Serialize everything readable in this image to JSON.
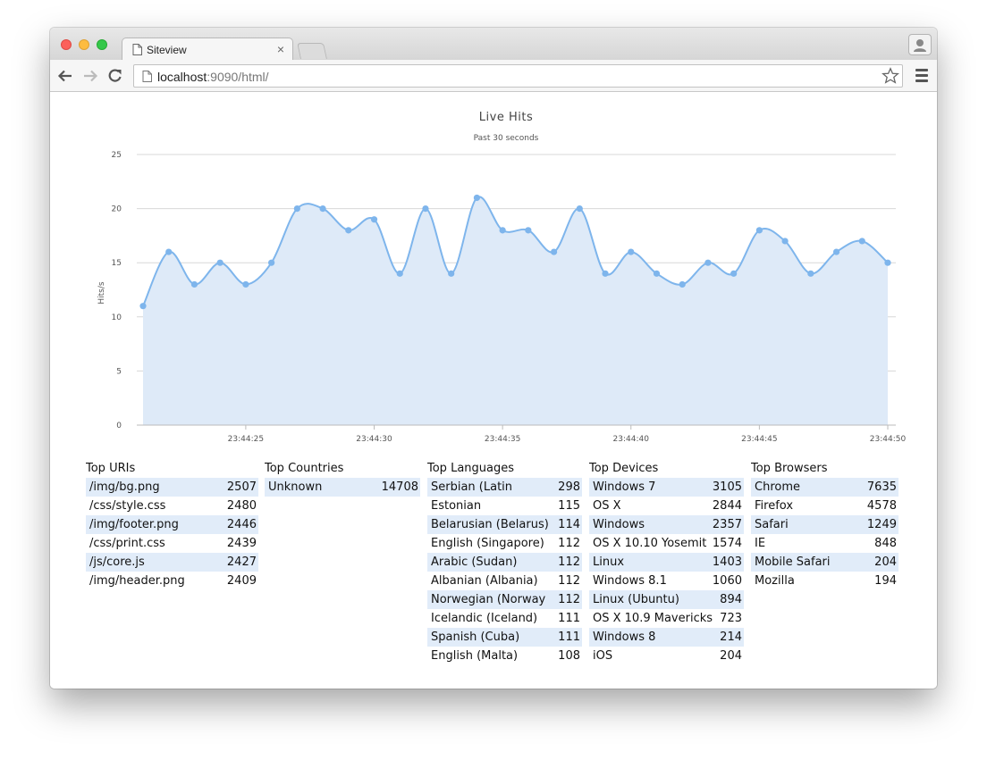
{
  "browser": {
    "tab_title": "Siteview",
    "tab_close": "×",
    "url_host": "localhost",
    "url_rest": ":9090/html/"
  },
  "chart_data": {
    "type": "area",
    "title": "Live Hits",
    "subtitle": "Past 30 seconds",
    "ylabel": "Hits/s",
    "xlabel": "",
    "ylim": [
      0,
      25
    ],
    "yticks": [
      0,
      5,
      10,
      15,
      20,
      25
    ],
    "grid": true,
    "x_ticks": [
      "23:44:25",
      "23:44:30",
      "23:44:35",
      "23:44:40",
      "23:44:45",
      "23:44:50"
    ],
    "x": [
      "23:44:21",
      "23:44:22",
      "23:44:23",
      "23:44:24",
      "23:44:25",
      "23:44:26",
      "23:44:27",
      "23:44:28",
      "23:44:29",
      "23:44:30",
      "23:44:31",
      "23:44:32",
      "23:44:33",
      "23:44:34",
      "23:44:35",
      "23:44:36",
      "23:44:37",
      "23:44:38",
      "23:44:39",
      "23:44:40",
      "23:44:41",
      "23:44:42",
      "23:44:43",
      "23:44:44",
      "23:44:45",
      "23:44:46",
      "23:44:47",
      "23:44:48",
      "23:44:49",
      "23:44:50"
    ],
    "series": [
      {
        "values": [
          11,
          16,
          13,
          15,
          13,
          15,
          20,
          20,
          18,
          19,
          14,
          20,
          14,
          21,
          18,
          18,
          16,
          20,
          14,
          16,
          14,
          13,
          15,
          14,
          18,
          17,
          14,
          16,
          17,
          15
        ]
      }
    ],
    "colors": {
      "line": "#7eb5ec",
      "fill": "#deeaf8",
      "grid": "#d8d8d8"
    }
  },
  "tables": [
    {
      "title": "Top URIs",
      "rows": [
        [
          "/img/bg.png",
          "2507"
        ],
        [
          "/css/style.css",
          "2480"
        ],
        [
          "/img/footer.png",
          "2446"
        ],
        [
          "/css/print.css",
          "2439"
        ],
        [
          "/js/core.js",
          "2427"
        ],
        [
          "/img/header.png",
          "2409"
        ]
      ]
    },
    {
      "title": "Top Countries",
      "rows": [
        [
          "Unknown",
          "14708"
        ]
      ]
    },
    {
      "title": "Top Languages",
      "rows": [
        [
          "Serbian (Latin",
          "298"
        ],
        [
          "Estonian",
          "115"
        ],
        [
          "Belarusian (Belarus)",
          "114"
        ],
        [
          "English (Singapore)",
          "112"
        ],
        [
          "Arabic (Sudan)",
          "112"
        ],
        [
          "Albanian (Albania)",
          "112"
        ],
        [
          "Norwegian (Norway",
          "112"
        ],
        [
          "Icelandic (Iceland)",
          "111"
        ],
        [
          "Spanish (Cuba)",
          "111"
        ],
        [
          "English (Malta)",
          "108"
        ]
      ]
    },
    {
      "title": "Top Devices",
      "rows": [
        [
          "Windows 7",
          "3105"
        ],
        [
          "OS X",
          "2844"
        ],
        [
          "Windows",
          "2357"
        ],
        [
          "OS X 10.10 Yosemite",
          "1574"
        ],
        [
          "Linux",
          "1403"
        ],
        [
          "Windows 8.1",
          "1060"
        ],
        [
          "Linux (Ubuntu)",
          "894"
        ],
        [
          "OS X 10.9 Mavericks",
          "723"
        ],
        [
          "Windows 8",
          "214"
        ],
        [
          "iOS",
          "204"
        ]
      ]
    },
    {
      "title": "Top Browsers",
      "rows": [
        [
          "Chrome",
          "7635"
        ],
        [
          "Firefox",
          "4578"
        ],
        [
          "Safari",
          "1249"
        ],
        [
          "IE",
          "848"
        ],
        [
          "Mobile Safari",
          "204"
        ],
        [
          "Mozilla",
          "194"
        ]
      ]
    }
  ]
}
